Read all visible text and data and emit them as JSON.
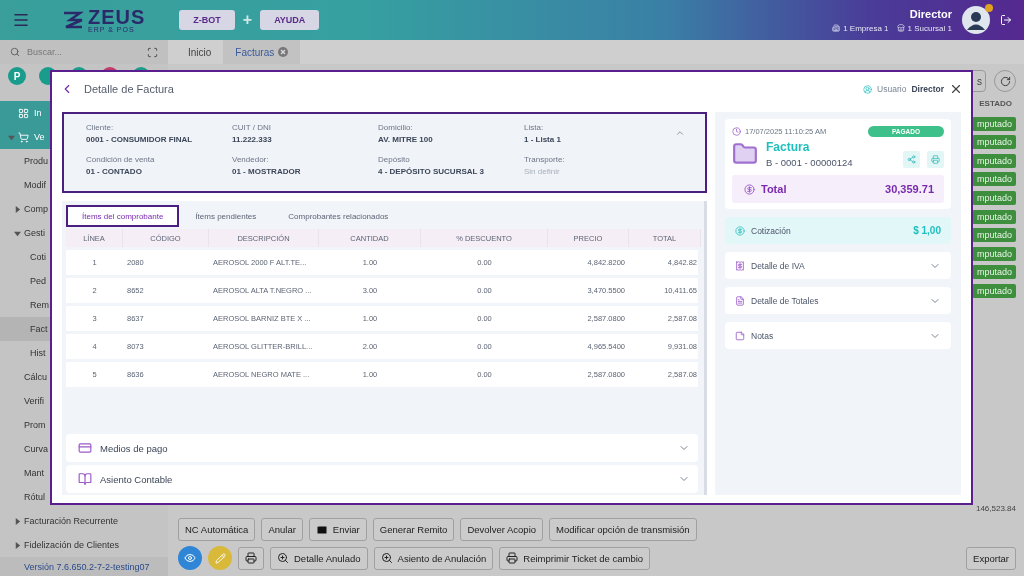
{
  "header": {
    "logo": {
      "name": "ZEUS",
      "tagline": "ERP & POS"
    },
    "buttons": [
      "Z-BOT",
      "AYUDA"
    ],
    "joiner": "+",
    "user": {
      "name": "Director",
      "company": "1 Empresa 1",
      "branch": "1 Sucursal 1"
    }
  },
  "sidebar": {
    "search": {
      "placeholder": "Buscar..."
    },
    "quick_links": [
      {
        "label": "P",
        "color": "#1a9c8c"
      },
      {
        "color": "#1a9c8c"
      },
      {
        "color": "#1a9c8c"
      },
      {
        "color": "#c23a6a"
      },
      {
        "color": "#1a9c8c"
      }
    ],
    "items": [
      {
        "label": "In",
        "kind": "module",
        "selected": false
      },
      {
        "label": "Ve",
        "kind": "module",
        "selected": false,
        "expanded": true,
        "children": [
          {
            "label": "Produ",
            "selected": false
          },
          {
            "label": "Modif",
            "selected": false
          },
          {
            "label": "Comp",
            "selected": false,
            "expanded": false
          },
          {
            "label": "Gesti",
            "selected": false,
            "expanded": true,
            "children": [
              {
                "label": "Coti",
                "selected": false
              },
              {
                "label": "Ped",
                "selected": false
              },
              {
                "label": "Rem",
                "selected": false
              },
              {
                "label": "Fact",
                "selected": true
              },
              {
                "label": "Hist",
                "selected": false
              }
            ]
          },
          {
            "label": "Cálcu",
            "selected": false
          },
          {
            "label": "Verifi",
            "selected": false
          },
          {
            "label": "Prom",
            "selected": false
          },
          {
            "label": "Curva",
            "selected": false
          },
          {
            "label": "Mant",
            "selected": false
          },
          {
            "label": "Rótul",
            "selected": false
          },
          {
            "label": "Facturación Recurrente",
            "selected": false,
            "expanded": false
          },
          {
            "label": "Fidelización de Clientes",
            "selected": false,
            "expanded": false
          }
        ]
      }
    ],
    "version": "Versión 7.6.650.2-7-2-testing07"
  },
  "tabs": [
    {
      "label": "Inicio",
      "selected": false,
      "closable": false
    },
    {
      "label": "Facturas",
      "selected": true,
      "closable": true
    }
  ],
  "list": {
    "toolbar_button": "s",
    "columns": [
      "ESTADO"
    ],
    "statuses": [
      "mputado",
      "mputado",
      "mputado",
      "mputado",
      "mputado",
      "mputado",
      "mputado",
      "mputado",
      "mputado",
      "mputado"
    ],
    "total": "146,523.84"
  },
  "actions": [
    [
      {
        "label": "NC Automática",
        "kind": "plain"
      },
      {
        "label": "Anular",
        "kind": "plain"
      },
      {
        "label": "Enviar",
        "kind": "mail"
      },
      {
        "label": "Generar Remito",
        "kind": "plain"
      },
      {
        "label": "Devolver Acopio",
        "kind": "plain"
      },
      {
        "label": "Modificar opción de transmisión",
        "kind": "plain"
      }
    ],
    [
      {
        "kind": "view"
      },
      {
        "kind": "edit"
      },
      {
        "kind": "print"
      },
      {
        "label": "Detalle Anulado",
        "kind": "zoom"
      },
      {
        "label": "Asiento de Anulación",
        "kind": "zoom"
      },
      {
        "label": "Reimprimir Ticket de cambio",
        "kind": "print"
      }
    ]
  ],
  "export": "Exportar",
  "invoice_modal": {
    "title": "Detalle de Factura",
    "user_label": "Usuario",
    "user": "Director",
    "client_info": {
      "expanded": true,
      "fields": [
        {
          "label": "Cliente:",
          "value": "0001 - CONSUMIDOR FINAL",
          "defined": true
        },
        {
          "label": "CUIT / DNI",
          "value": "11.222.333",
          "defined": true
        },
        {
          "label": "Domicilio:",
          "value": "AV. MITRE 100",
          "defined": true
        },
        {
          "label": "Lista:",
          "value": "1 - Lista 1",
          "defined": true
        },
        {
          "label": "Condición de venta",
          "value": "01 - CONTADO",
          "defined": true
        },
        {
          "label": "Vendedor:",
          "value": "01 - MOSTRADOR",
          "defined": true
        },
        {
          "label": "Depósito",
          "value": "4 - DEPÓSITO SUCURSAL 3",
          "defined": true
        },
        {
          "label": "Transporte:",
          "value": "Sin definir",
          "defined": false
        }
      ]
    },
    "tabs": [
      {
        "label": "Ítems del comprobante",
        "selected": true
      },
      {
        "label": "Ítems pendientes",
        "selected": false
      },
      {
        "label": "Comprobantes relacionados",
        "selected": false
      }
    ],
    "table": {
      "columns": [
        "LÍNEA",
        "CÓDIGO",
        "DESCRIPCIÓN",
        "CANTIDAD",
        "% DESCUENTO",
        "PRECIO",
        "TOTAL"
      ],
      "rows": [
        [
          "1",
          "2080",
          "AEROSOL 2000 F ALT.TE...",
          "1.00",
          "0.00",
          "4,842.8200",
          "4,842.82"
        ],
        [
          "2",
          "8652",
          "AEROSOL ALTA T.NEGRO ...",
          "3.00",
          "0.00",
          "3,470.5500",
          "10,411.65"
        ],
        [
          "3",
          "8637",
          "AEROSOL BARNIZ BTE X ...",
          "1.00",
          "0.00",
          "2,587.0800",
          "2,587.08"
        ],
        [
          "4",
          "8073",
          "AEROSOL GLITTER-BRILL...",
          "2.00",
          "0.00",
          "4,965.5400",
          "9,931.08"
        ],
        [
          "5",
          "8636",
          "AEROSOL NEGRO MATE ...",
          "1.00",
          "0.00",
          "2,587.0800",
          "2,587.08"
        ]
      ]
    },
    "sections": [
      {
        "label": "Medios de pago",
        "expanded": false
      },
      {
        "label": "Asiento Contable",
        "expanded": false
      }
    ],
    "summary": {
      "date": "17/07/2025 11:10:25 AM",
      "status": "PAGADO",
      "doc_type": "Factura",
      "number": "B - 0001 - 00000124",
      "total_label": "Total",
      "total": "30,359.71"
    },
    "exchange": {
      "label": "Cotización",
      "value": "$ 1,00"
    },
    "details": [
      {
        "label": "Detalle de IVA",
        "expanded": false
      },
      {
        "label": "Detalle de Totales",
        "expanded": false
      },
      {
        "label": "Notas",
        "expanded": false
      }
    ]
  }
}
